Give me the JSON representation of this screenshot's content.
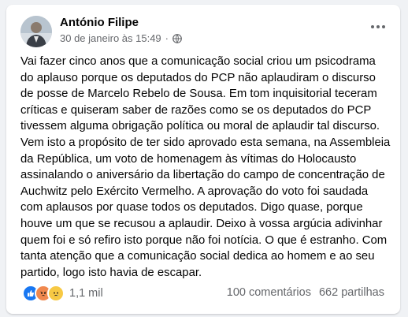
{
  "post": {
    "author": "António Filipe",
    "timestamp": "30 de janeiro às 15:49",
    "separator": "·",
    "audience_icon": "globe-icon",
    "menu_icon": "more-options-icon",
    "text": "Vai fazer cinco anos que a comunicação social criou um psicodrama do aplauso porque os deputados do PCP não aplaudiram o discurso de posse de Marcelo Rebelo de Sousa. Em tom inquisitorial teceram críticas e quiseram saber de razões como se os deputados do PCP tivessem alguma obrigação política ou moral de aplaudir tal discurso.\nVem isto a propósito de ter sido aprovado esta semana, na Assembleia da República, um voto de homenagem às vítimas do Holocausto assinalando o aniversário da libertação do campo de concentração de Auchwitz pelo Exército Vermelho. A aprovação do voto foi saudada com aplausos por quase todos os deputados. Digo quase, porque houve um que se recusou a aplaudir. Deixo à vossa argúcia adivinhar quem foi e só refiro isto porque não foi notícia. O que é estranho. Com tanta atenção que a comunicação social dedica ao homem e ao seu partido, logo isto havia de escapar."
  },
  "engagement": {
    "reactions": [
      "like-icon",
      "angry-icon",
      "sad-icon"
    ],
    "reaction_count": "1,1 mil",
    "comments": "100 comentários",
    "shares": "662 partilhas"
  },
  "colors": {
    "like": "#1877f2",
    "angry": "#f0884e",
    "sad": "#f7c944",
    "secondary_text": "#65676b"
  }
}
